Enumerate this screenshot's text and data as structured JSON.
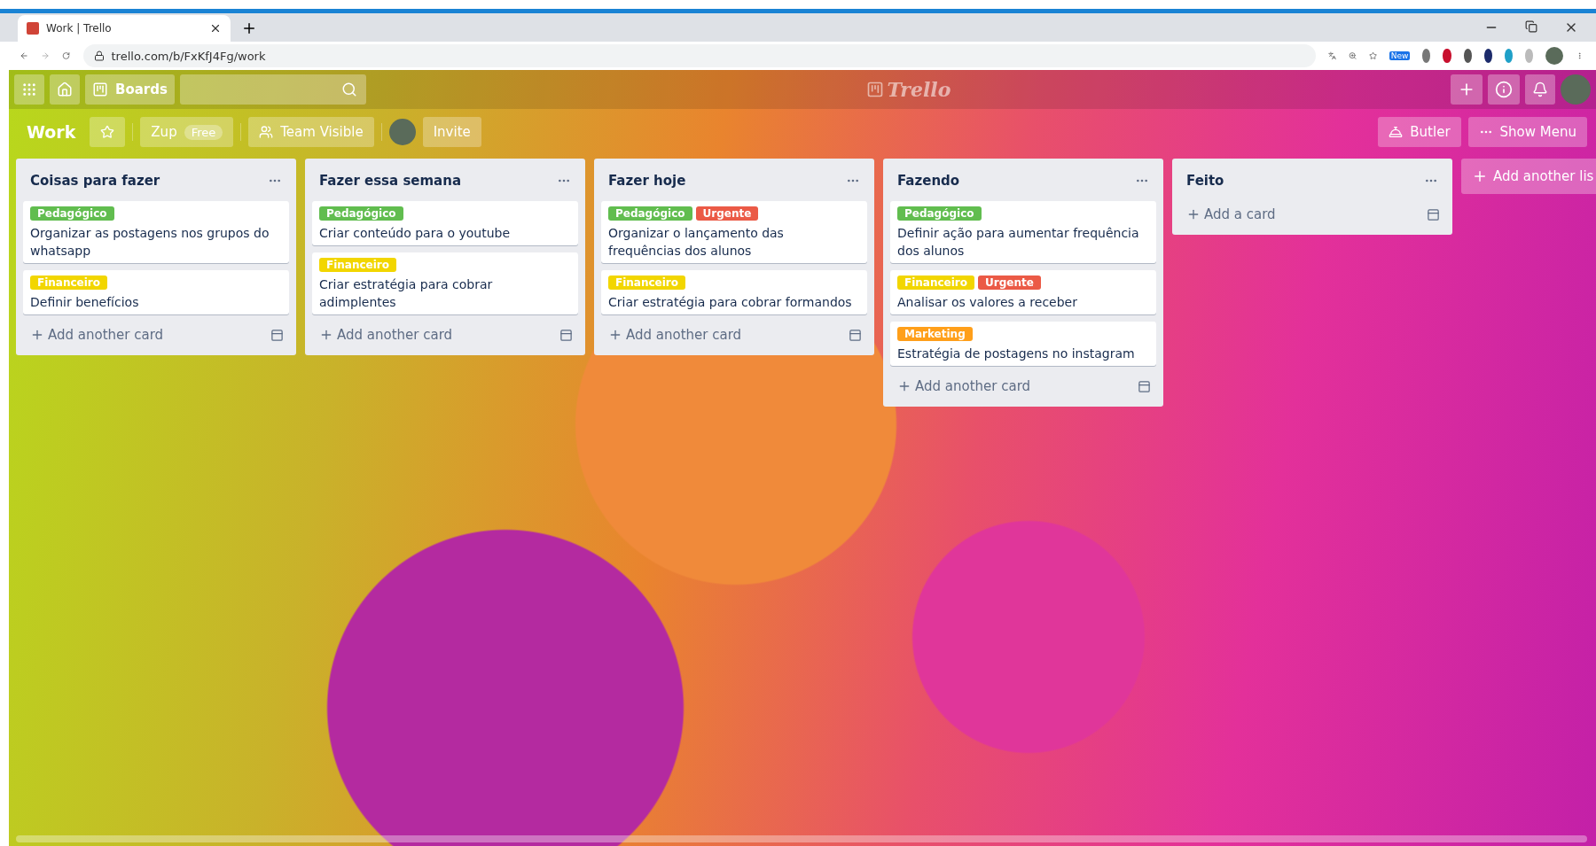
{
  "browser": {
    "tab_title": "Work | Trello",
    "url": "trello.com/b/FxKfJ4Fg/work",
    "extension_badge": "New"
  },
  "header": {
    "boards_button": "Boards",
    "logo": "Trello"
  },
  "board": {
    "title": "Work",
    "team": "Zup",
    "team_badge": "Free",
    "visibility": "Team Visible",
    "invite": "Invite",
    "butler": "Butler",
    "menu": "Show Menu"
  },
  "lists": [
    {
      "title": "Coisas para fazer",
      "add_text": "Add another card",
      "cards": [
        {
          "labels": [
            {
              "text": "Pedagógico",
              "color": "#61bd4f"
            }
          ],
          "title": "Organizar as postagens nos grupos do whatsapp"
        },
        {
          "labels": [
            {
              "text": "Financeiro",
              "color": "#f2d600"
            }
          ],
          "title": "Definir benefícios"
        }
      ]
    },
    {
      "title": "Fazer essa semana",
      "add_text": "Add another card",
      "cards": [
        {
          "labels": [
            {
              "text": "Pedagógico",
              "color": "#61bd4f"
            }
          ],
          "title": "Criar conteúdo para o youtube"
        },
        {
          "labels": [
            {
              "text": "Financeiro",
              "color": "#f2d600"
            }
          ],
          "title": "Criar estratégia para cobrar adimplentes"
        }
      ]
    },
    {
      "title": "Fazer hoje",
      "add_text": "Add another card",
      "cards": [
        {
          "labels": [
            {
              "text": "Pedagógico",
              "color": "#61bd4f"
            },
            {
              "text": "Urgente",
              "color": "#eb5a46"
            }
          ],
          "title": "Organizar o lançamento das frequências dos alunos"
        },
        {
          "labels": [
            {
              "text": "Financeiro",
              "color": "#f2d600"
            }
          ],
          "title": "Criar estratégia para cobrar formandos"
        }
      ]
    },
    {
      "title": "Fazendo",
      "add_text": "Add another card",
      "cards": [
        {
          "labels": [
            {
              "text": "Pedagógico",
              "color": "#61bd4f"
            }
          ],
          "title": "Definir ação para aumentar frequência dos alunos"
        },
        {
          "labels": [
            {
              "text": "Financeiro",
              "color": "#f2d600"
            },
            {
              "text": "Urgente",
              "color": "#eb5a46"
            }
          ],
          "title": "Analisar os valores a receber"
        },
        {
          "labels": [
            {
              "text": "Marketing",
              "color": "#ff9f1a"
            }
          ],
          "title": "Estratégia de postagens no instagram"
        }
      ]
    },
    {
      "title": "Feito",
      "add_text": "Add a card"
    }
  ],
  "add_list": "Add another lis"
}
